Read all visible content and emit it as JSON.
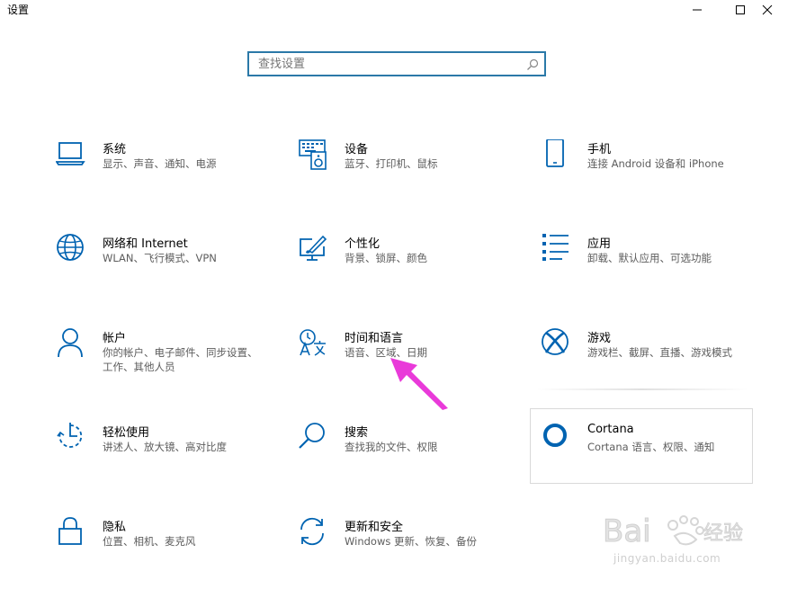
{
  "window": {
    "title": "设置",
    "minimize_icon": "minimize-icon",
    "maximize_icon": "maximize-icon",
    "close_icon": "close-icon"
  },
  "search": {
    "placeholder": "查找设置",
    "value": "",
    "icon": "search-icon"
  },
  "tiles": [
    {
      "name": "系统",
      "desc": "显示、声音、通知、电源",
      "icon": "laptop-icon"
    },
    {
      "name": "设备",
      "desc": "蓝牙、打印机、鼠标",
      "icon": "keyboard-speaker-icon"
    },
    {
      "name": "手机",
      "desc": "连接 Android 设备和 iPhone",
      "icon": "phone-icon"
    },
    {
      "name": "网络和 Internet",
      "desc": "WLAN、飞行模式、VPN",
      "icon": "globe-icon"
    },
    {
      "name": "个性化",
      "desc": "背景、锁屏、颜色",
      "icon": "paint-monitor-icon"
    },
    {
      "name": "应用",
      "desc": "卸载、默认应用、可选功能",
      "icon": "app-list-icon"
    },
    {
      "name": "帐户",
      "desc": "你的帐户、电子邮件、同步设置、工作、其他人员",
      "icon": "person-icon"
    },
    {
      "name": "时间和语言",
      "desc": "语音、区域、日期",
      "icon": "time-language-icon"
    },
    {
      "name": "游戏",
      "desc": "游戏栏、截屏、直播、游戏模式",
      "icon": "xbox-icon"
    },
    {
      "name": "轻松使用",
      "desc": "讲述人、放大镜、高对比度",
      "icon": "ease-of-access-icon"
    },
    {
      "name": "搜索",
      "desc": "查找我的文件、权限",
      "icon": "search-magnifier-icon"
    },
    {
      "name": "Cortana",
      "desc": "Cortana 语言、权限、通知",
      "icon": "cortana-ring-icon"
    },
    {
      "name": "隐私",
      "desc": "位置、相机、麦克风",
      "icon": "lock-icon"
    },
    {
      "name": "更新和安全",
      "desc": "Windows 更新、恢复、备份",
      "icon": "update-sync-icon"
    }
  ],
  "watermark": {
    "text": "jingyan.baidu.com",
    "logo": "baidu-jingyan-logo"
  },
  "accent_color": "#0063b1",
  "annotation_arrow_color": "#e93ad9"
}
